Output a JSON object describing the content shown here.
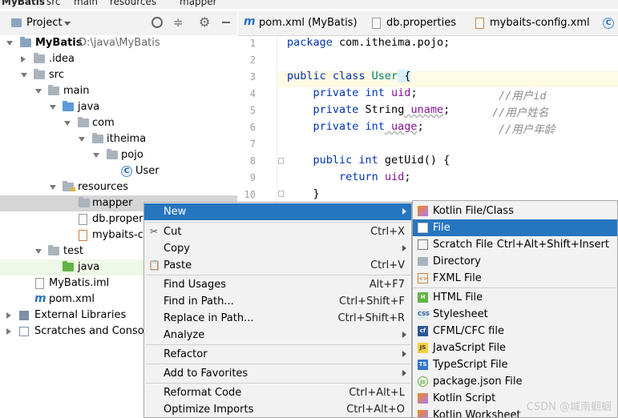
{
  "breadcrumb": [
    "MyBatis",
    "src",
    "main",
    "resources",
    "mapper"
  ],
  "project_panel": {
    "title": "Project",
    "tree": [
      {
        "label": "MyBatis",
        "path": "D:\\java\\MyBatis",
        "type": "module"
      },
      {
        "label": ".idea",
        "type": "folder"
      },
      {
        "label": "src",
        "type": "folder"
      },
      {
        "label": "main",
        "type": "folder"
      },
      {
        "label": "java",
        "type": "source-folder"
      },
      {
        "label": "com",
        "type": "package"
      },
      {
        "label": "itheima",
        "type": "package"
      },
      {
        "label": "pojo",
        "type": "package"
      },
      {
        "label": "User",
        "type": "class"
      },
      {
        "label": "resources",
        "type": "resources-folder"
      },
      {
        "label": "mapper",
        "type": "folder"
      },
      {
        "label": "db.propert",
        "type": "properties"
      },
      {
        "label": "mybaits-co",
        "type": "xml"
      },
      {
        "label": "test",
        "type": "folder"
      },
      {
        "label": "java",
        "type": "test-source-folder"
      },
      {
        "label": "MyBatis.iml",
        "type": "iml"
      },
      {
        "label": "pom.xml",
        "type": "maven"
      },
      {
        "label": "External Libraries",
        "type": "libraries"
      },
      {
        "label": "Scratches and Consoles",
        "type": "scratches"
      }
    ]
  },
  "tabs": [
    {
      "label": "pom.xml (MyBatis)",
      "icon": "maven-icon"
    },
    {
      "label": "db.properties",
      "icon": "properties-icon"
    },
    {
      "label": "mybaits-config.xml",
      "icon": "xml-icon"
    }
  ],
  "editor": {
    "line_numbers": [
      "1",
      "2",
      "3",
      "4",
      "5",
      "6",
      "7",
      "8",
      "9",
      "10"
    ],
    "lines": [
      {
        "kw": "package",
        "rest": " com.itheima.pojo;"
      },
      {},
      {
        "kw": "public class",
        "cls": " User",
        "rest": " {"
      },
      {
        "indent": "    ",
        "kw": "private int",
        "fld": " uid",
        "rest": ";",
        "cmt": "//用户id"
      },
      {
        "indent": "    ",
        "kw": "private",
        "type": " String",
        "fld": " uname",
        "rest": ";",
        "cmt": "//用户姓名"
      },
      {
        "indent": "    ",
        "kw": "private int",
        "fld": " uage",
        "rest": ";",
        "cmt": "//用户年龄"
      },
      {},
      {
        "indent": "    ",
        "kw": "public int",
        "rest": " getUid() {"
      },
      {
        "indent": "        ",
        "kw": "return",
        "fld": " uid",
        "rest": ";"
      },
      {
        "indent": "    ",
        "rest": "}"
      }
    ]
  },
  "context_menu": [
    {
      "label": "New",
      "submenu": true,
      "selected": true
    },
    {
      "label": "Cut",
      "shortcut": "Ctrl+X",
      "icon": "scissors-icon"
    },
    {
      "label": "Copy",
      "submenu": true
    },
    {
      "label": "Paste",
      "shortcut": "Ctrl+V",
      "icon": "paste-icon"
    },
    {
      "label": "Find Usages",
      "shortcut": "Alt+F7"
    },
    {
      "label": "Find in Path...",
      "shortcut": "Ctrl+Shift+F"
    },
    {
      "label": "Replace in Path...",
      "shortcut": "Ctrl+Shift+R"
    },
    {
      "label": "Analyze",
      "submenu": true
    },
    {
      "label": "Refactor",
      "submenu": true
    },
    {
      "label": "Add to Favorites",
      "submenu": true
    },
    {
      "label": "Reformat Code",
      "shortcut": "Ctrl+Alt+L"
    },
    {
      "label": "Optimize Imports",
      "shortcut": "Ctrl+Alt+O"
    }
  ],
  "new_submenu": [
    {
      "label": "Kotlin File/Class",
      "icon": "kotlin-icon"
    },
    {
      "label": "File",
      "icon": "file-icon",
      "selected": true
    },
    {
      "label": "Scratch File",
      "shortcut": "Ctrl+Alt+Shift+Insert",
      "icon": "scratch-icon"
    },
    {
      "label": "Directory",
      "icon": "folder-icon"
    },
    {
      "label": "FXML File",
      "icon": "fxml-icon"
    },
    {
      "label": "HTML File",
      "icon": "html-icon"
    },
    {
      "label": "Stylesheet",
      "icon": "css-icon"
    },
    {
      "label": "CFML/CFC file",
      "icon": "cfml-icon"
    },
    {
      "label": "JavaScript File",
      "icon": "js-icon"
    },
    {
      "label": "TypeScript File",
      "icon": "ts-icon"
    },
    {
      "label": "package.json File",
      "icon": "node-icon"
    },
    {
      "label": "Kotlin Script",
      "icon": "kotlin-icon"
    },
    {
      "label": "Kotlin Worksheet",
      "icon": "kotlin-icon"
    }
  ],
  "watermark": "CSDN @城南蝈蝈",
  "colors": {
    "selection": "#2675bf",
    "keyword": "#0033b3",
    "field": "#871094",
    "comment": "#8c8c8c"
  }
}
